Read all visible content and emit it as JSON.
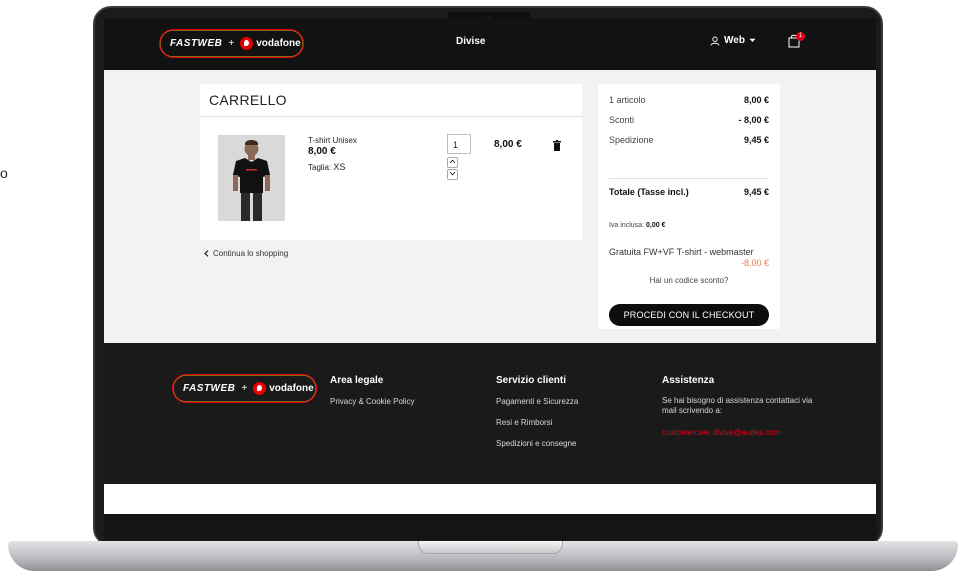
{
  "header": {
    "brand_left": "FASTWEB",
    "brand_plus": "+",
    "brand_right": "vodafone",
    "title": "Divise",
    "user_label": "Web",
    "cart_count": "1"
  },
  "cart": {
    "heading": "CARRELLO",
    "item": {
      "name": "T-shirt Unisex",
      "price": "8,00 €",
      "size_label": "Taglia:",
      "size_value": "XS",
      "quantity": "1",
      "line_total": "8,00 €"
    },
    "continue_label": "Continua lo shopping"
  },
  "summary": {
    "items_label": "1 articolo",
    "items_value": "8,00 €",
    "discount_label": "Sconti",
    "discount_value": "- 8,00 €",
    "shipping_label": "Spedizione",
    "shipping_value": "9,45 €",
    "total_label": "Totale (Tasse incl.)",
    "total_value": "9,45 €",
    "vat_label": "Iva inclusa:",
    "vat_value": "0,00 €",
    "promo_name": "Gratuita FW+VF T-shirt - webmaster",
    "promo_amount": "-8,00 €",
    "code_link": "Hai un codice sconto?",
    "checkout_label": "PROCEDI CON IL CHECKOUT"
  },
  "footer": {
    "legal_title": "Area legale",
    "legal_links": [
      "Privacy & Cookie Policy"
    ],
    "service_title": "Servizio clienti",
    "service_links": [
      "Pagamenti e Sicurezza",
      "Resi e Rimborsi",
      "Spedizioni e consegne"
    ],
    "support_title": "Assistenza",
    "support_text": "Se hai bisogno di assistenza contattaci via mail scrivendo a:",
    "support_email": "customercare.divise@audes.com"
  },
  "colors": {
    "accent_red": "#e2001a",
    "promo_orange": "#f07a4c",
    "dark": "#121212"
  }
}
